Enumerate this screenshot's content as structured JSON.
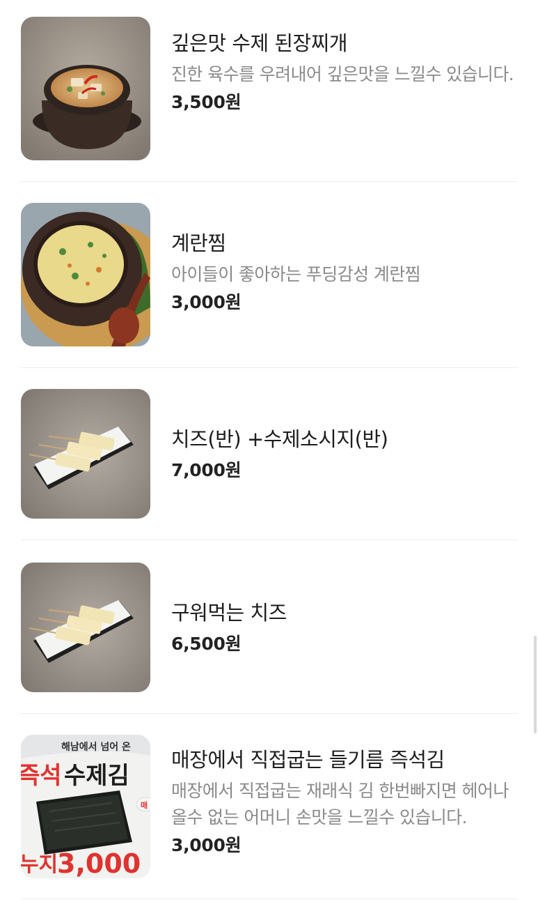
{
  "menu_items": [
    {
      "name": "깊은맛 수제 된장찌개",
      "description": "진한 육수를 우려내어 깊은맛을 느낄수 있습니다.",
      "price": "3,500원",
      "image_icon": "doenjang-stew-photo"
    },
    {
      "name": "계란찜",
      "description": "아이들이 좋아하는 푸딩감성 계란찜",
      "price": "3,000원",
      "image_icon": "steamed-egg-photo"
    },
    {
      "name": "치즈(반) +수제소시지(반)",
      "description": "",
      "price": "7,000원",
      "image_icon": "cheese-sausage-skewers-photo"
    },
    {
      "name": "구워먹는 치즈",
      "description": "",
      "price": "6,500원",
      "image_icon": "grilled-cheese-skewers-photo"
    },
    {
      "name": "매장에서 직접굽는 들기름 즉석김",
      "description": "매장에서 직접굽는 재래식 김 한번빠지면 헤어나올수 없는 어머니 손맛을 느낄수 있습니다.",
      "price": "3,000원",
      "image_icon": "seasoned-laver-photo",
      "image_text": {
        "top": "해남에서 넘어 온",
        "headline_left": "즉석",
        "headline_right": "수제김",
        "bottom_left": "누지",
        "bottom_price": "3,000",
        "badge": "매"
      }
    }
  ],
  "colors": {
    "name": "#1e1e1e",
    "description": "#8a8a8a",
    "price": "#222222",
    "divider": "#ececec",
    "laver_red": "#e0322e"
  }
}
